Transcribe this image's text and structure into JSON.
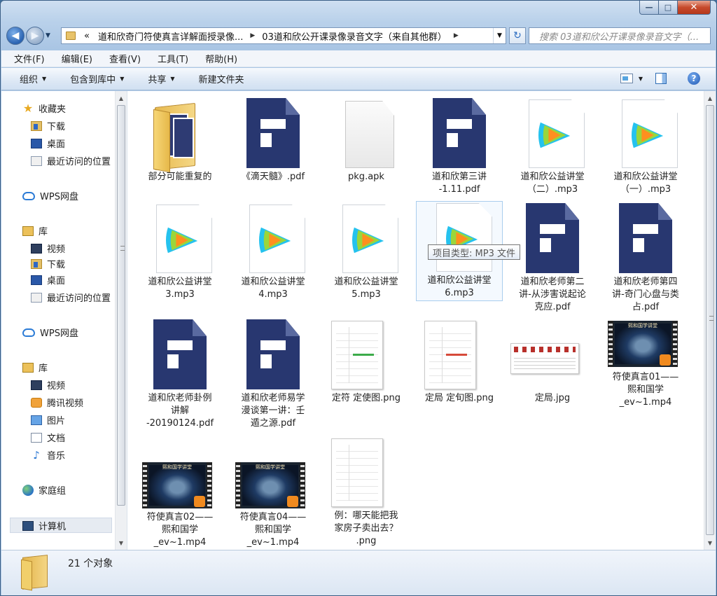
{
  "window": {
    "caption": {
      "minimize": "—",
      "maximize": "□",
      "close": "✕"
    }
  },
  "nav": {
    "address": {
      "prefix": "«",
      "segments": [
        "道和欣奇门符使真言详解面授录像...",
        "03道和欣公开课录像录音文字（来自其他群）"
      ]
    },
    "search_placeholder": "搜索 03道和欣公开课录像录音文字（..."
  },
  "menu": [
    "文件(F)",
    "编辑(E)",
    "查看(V)",
    "工具(T)",
    "帮助(H)"
  ],
  "toolbar": {
    "organize": "组织",
    "include_library": "包含到库中",
    "share": "共享",
    "new_folder": "新建文件夹"
  },
  "sidebar": {
    "favorites": {
      "title": "收藏夹",
      "items": [
        "下载",
        "桌面",
        "最近访问的位置"
      ]
    },
    "wps1": "WPS网盘",
    "library1": {
      "title": "库",
      "items": [
        "视频",
        "下载",
        "桌面",
        "最近访问的位置"
      ]
    },
    "wps2": "WPS网盘",
    "library2": {
      "title": "库",
      "items": [
        "视频",
        "腾讯视频",
        "图片",
        "文档",
        "音乐"
      ]
    },
    "homegroup": "家庭组",
    "computer": "计算机"
  },
  "files": [
    {
      "name": "部分可能重复的",
      "type": "folder"
    },
    {
      "name": "《滴天髓》.pdf",
      "type": "pdf"
    },
    {
      "name": "pkg.apk",
      "type": "apk"
    },
    {
      "name": "道和欣第三讲\n-1.11.pdf",
      "type": "pdf"
    },
    {
      "name": "道和欣公益讲堂\n（二）.mp3",
      "type": "mp3"
    },
    {
      "name": "道和欣公益讲堂\n（一）.mp3",
      "type": "mp3"
    },
    {
      "name": "道和欣公益讲堂\n3.mp3",
      "type": "mp3"
    },
    {
      "name": "道和欣公益讲堂\n4.mp3",
      "type": "mp3"
    },
    {
      "name": "道和欣公益讲堂\n5.mp3",
      "type": "mp3"
    },
    {
      "name": "道和欣公益讲堂\n6.mp3",
      "type": "mp3"
    },
    {
      "name": "道和欣老师第二\n讲-从涉害说起论\n克应.pdf",
      "type": "pdf"
    },
    {
      "name": "道和欣老师第四\n讲-奇门心盘与类\n占.pdf",
      "type": "pdf"
    },
    {
      "name": "道和欣老师卦例\n讲解\n-20190124.pdf",
      "type": "pdf"
    },
    {
      "name": "道和欣老师易学\n漫谈第一讲：壬\n遁之源.pdf",
      "type": "pdf"
    },
    {
      "name": "定符 定使图.png",
      "type": "png"
    },
    {
      "name": "定局 定旬图.png",
      "type": "png"
    },
    {
      "name": "定局.jpg",
      "type": "jpg"
    },
    {
      "name": "符使真言01——\n熙和国学\n_ev~1.mp4",
      "type": "mp4"
    },
    {
      "name": "符使真言02——\n熙和国学\n_ev~1.mp4",
      "type": "mp4"
    },
    {
      "name": "符使真言04——\n熙和国学\n_ev~1.mp4",
      "type": "mp4"
    },
    {
      "name": "例：哪天能把我\n家房子卖出去？\n.png",
      "type": "png"
    }
  ],
  "tooltip": "项目类型: MP3 文件",
  "video_caption": "熙和国学讲堂",
  "status": {
    "count": "21 个对象"
  },
  "colors": {
    "pdf": "#283770",
    "accent": "#2b6cc0",
    "close": "#c74a2c"
  }
}
